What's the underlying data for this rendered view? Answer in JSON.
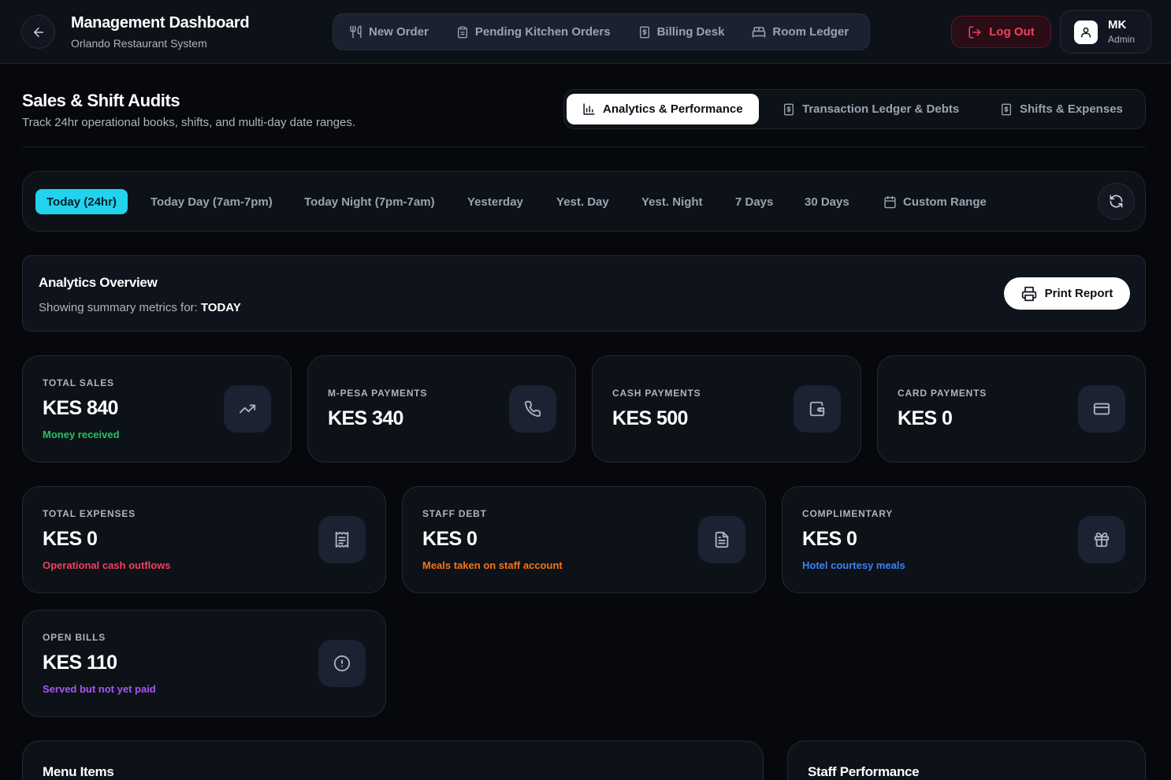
{
  "header": {
    "title": "Management Dashboard",
    "subtitle": "Orlando Restaurant System",
    "nav": [
      {
        "label": "New Order",
        "icon": "utensils-icon"
      },
      {
        "label": "Pending Kitchen Orders",
        "icon": "clipboard-icon"
      },
      {
        "label": "Billing Desk",
        "icon": "receipt-dollar-icon"
      },
      {
        "label": "Room Ledger",
        "icon": "bed-icon"
      }
    ],
    "logout_label": "Log Out",
    "user": {
      "initials": "MK",
      "role": "Admin"
    }
  },
  "page": {
    "title": "Sales & Shift Audits",
    "subtitle": "Track 24hr operational books, shifts, and multi-day date ranges.",
    "tabs": [
      {
        "label": "Analytics & Performance",
        "active": true
      },
      {
        "label": "Transaction Ledger & Debts",
        "active": false
      },
      {
        "label": "Shifts & Expenses",
        "active": false
      }
    ]
  },
  "filters": {
    "ranges": [
      "Today (24hr)",
      "Today Day (7am-7pm)",
      "Today Night (7pm-7am)",
      "Yesterday",
      "Yest. Day",
      "Yest. Night",
      "7 Days",
      "30 Days"
    ],
    "active_index": 0,
    "custom_label": "Custom Range"
  },
  "overview": {
    "title": "Analytics Overview",
    "prefix": "Showing summary metrics for:",
    "period": "TODAY",
    "print_label": "Print Report"
  },
  "stats": {
    "total_sales": {
      "label": "TOTAL SALES",
      "value": "KES 840",
      "note": "Money received",
      "icon": "trending-up-icon",
      "note_color": "#22c55e"
    },
    "mpesa": {
      "label": "M-PESA PAYMENTS",
      "value": "KES 340",
      "icon": "phone-icon"
    },
    "cash": {
      "label": "CASH PAYMENTS",
      "value": "KES 500",
      "icon": "wallet-icon"
    },
    "card": {
      "label": "CARD PAYMENTS",
      "value": "KES 0",
      "icon": "credit-card-icon"
    },
    "expenses": {
      "label": "TOTAL EXPENSES",
      "value": "KES 0",
      "note": "Operational cash outflows",
      "icon": "receipt-icon",
      "note_color": "#f43f5e"
    },
    "staff_debt": {
      "label": "STAFF DEBT",
      "value": "KES 0",
      "note": "Meals taken on staff account",
      "icon": "file-text-icon",
      "note_color": "#f97316"
    },
    "complimentary": {
      "label": "COMPLIMENTARY",
      "value": "KES 0",
      "note": "Hotel courtesy meals",
      "icon": "gift-icon",
      "note_color": "#3b82f6"
    },
    "open_bills": {
      "label": "OPEN BILLS",
      "value": "KES 110",
      "note": "Served but not yet paid",
      "icon": "alert-circle-icon",
      "note_color": "#a855f7"
    }
  },
  "panels": {
    "menu_items": "Menu Items",
    "staff_performance": "Staff Performance"
  }
}
